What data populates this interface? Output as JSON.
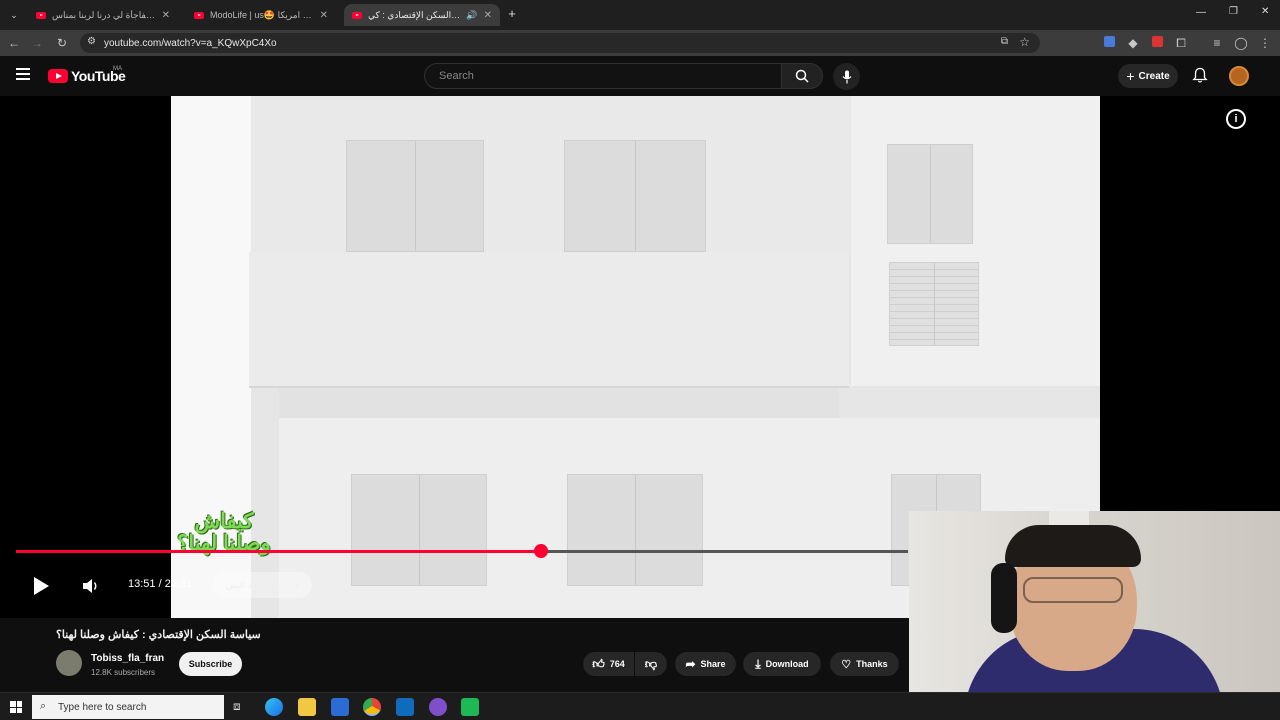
{
  "browser": {
    "tabs": [
      {
        "title": "شوفو المفاجأة لي درنا لربنا بمناس...",
        "active": false
      },
      {
        "title": "ModoLife | us🤩 في امريكا DER...",
        "active": false
      },
      {
        "title": "سياسة السكن الإقتصادي : كي...",
        "active": true
      }
    ],
    "new_tab": "+",
    "address": "youtube.com/watch?v=a_KQwXpC4Xo"
  },
  "youtube": {
    "logo": "YouTube",
    "region": "MA",
    "search_placeholder": "Search",
    "create_label": "Create"
  },
  "player": {
    "current_time": "13:51",
    "duration": "23:31",
    "time_separator": "/",
    "progress_fraction": 0.589,
    "chapter_label": "نتيجة هاد البش",
    "overlay_text": "كيفاش وصلنا لهنا؟"
  },
  "video": {
    "title": "سياسة السكن الإقتصادي : كيفاش وصلنا لهنا؟",
    "channel": "Tobiss_fla_fran",
    "subscribers": "12.8K subscribers",
    "subscribe_label": "Subscribe",
    "likes": "764",
    "share_label": "Share",
    "download_label": "Download",
    "thanks_label": "Thanks"
  },
  "taskbar": {
    "search_placeholder": "Type here to search"
  },
  "colors": {
    "accent": "#ff0033",
    "background": "#0f0f0f",
    "overlay_green": "#7ed957"
  }
}
